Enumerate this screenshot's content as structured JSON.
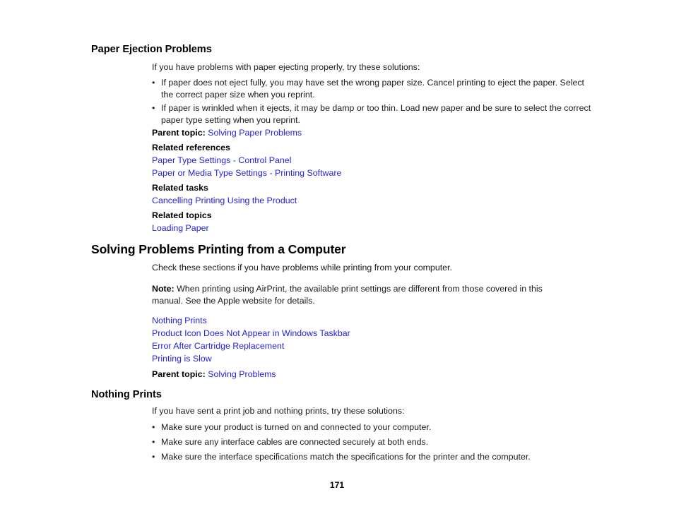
{
  "page": {
    "number": "171",
    "background_color": "#ffffff",
    "text_color": "#1a1a1a",
    "link_color": "#2323d8"
  },
  "section_paper_ejection": {
    "heading": "Paper Ejection Problems",
    "intro": "If you have problems with paper ejecting properly, try these solutions:",
    "bullets": [
      "If paper does not eject fully, you may have set the wrong paper size. Cancel printing to eject the paper. Select the correct paper size when you reprint.",
      "If paper is wrinkled when it ejects, it may be damp or too thin. Load new paper and be sure to select the correct paper type setting when you reprint."
    ],
    "parent_topic_label": "Parent topic:",
    "parent_topic_link": "Solving Paper Problems",
    "related_references_label": "Related references",
    "related_references_links": [
      "Paper Type Settings - Control Panel",
      "Paper or Media Type Settings - Printing Software"
    ],
    "related_tasks_label": "Related tasks",
    "related_tasks_links": [
      "Cancelling Printing Using the Product"
    ],
    "related_topics_label": "Related topics",
    "related_topics_links": [
      "Loading Paper"
    ]
  },
  "section_solving_printing": {
    "heading": "Solving Problems Printing from a Computer",
    "intro": "Check these sections if you have problems while printing from your computer.",
    "note_label": "Note:",
    "note_text": " When printing using AirPrint, the available print settings are different from those covered in this manual. See the Apple website for details.",
    "links": [
      "Nothing Prints",
      "Product Icon Does Not Appear in Windows Taskbar",
      "Error After Cartridge Replacement",
      "Printing is Slow"
    ],
    "parent_topic_label": "Parent topic:",
    "parent_topic_link": "Solving Problems"
  },
  "section_nothing_prints": {
    "heading": "Nothing Prints",
    "intro": "If you have sent a print job and nothing prints, try these solutions:",
    "bullets": [
      "Make sure your product is turned on and connected to your computer.",
      "Make sure any interface cables are connected securely at both ends.",
      "Make sure the interface specifications match the specifications for the printer and the computer."
    ]
  },
  "bullet_glyph": "•"
}
